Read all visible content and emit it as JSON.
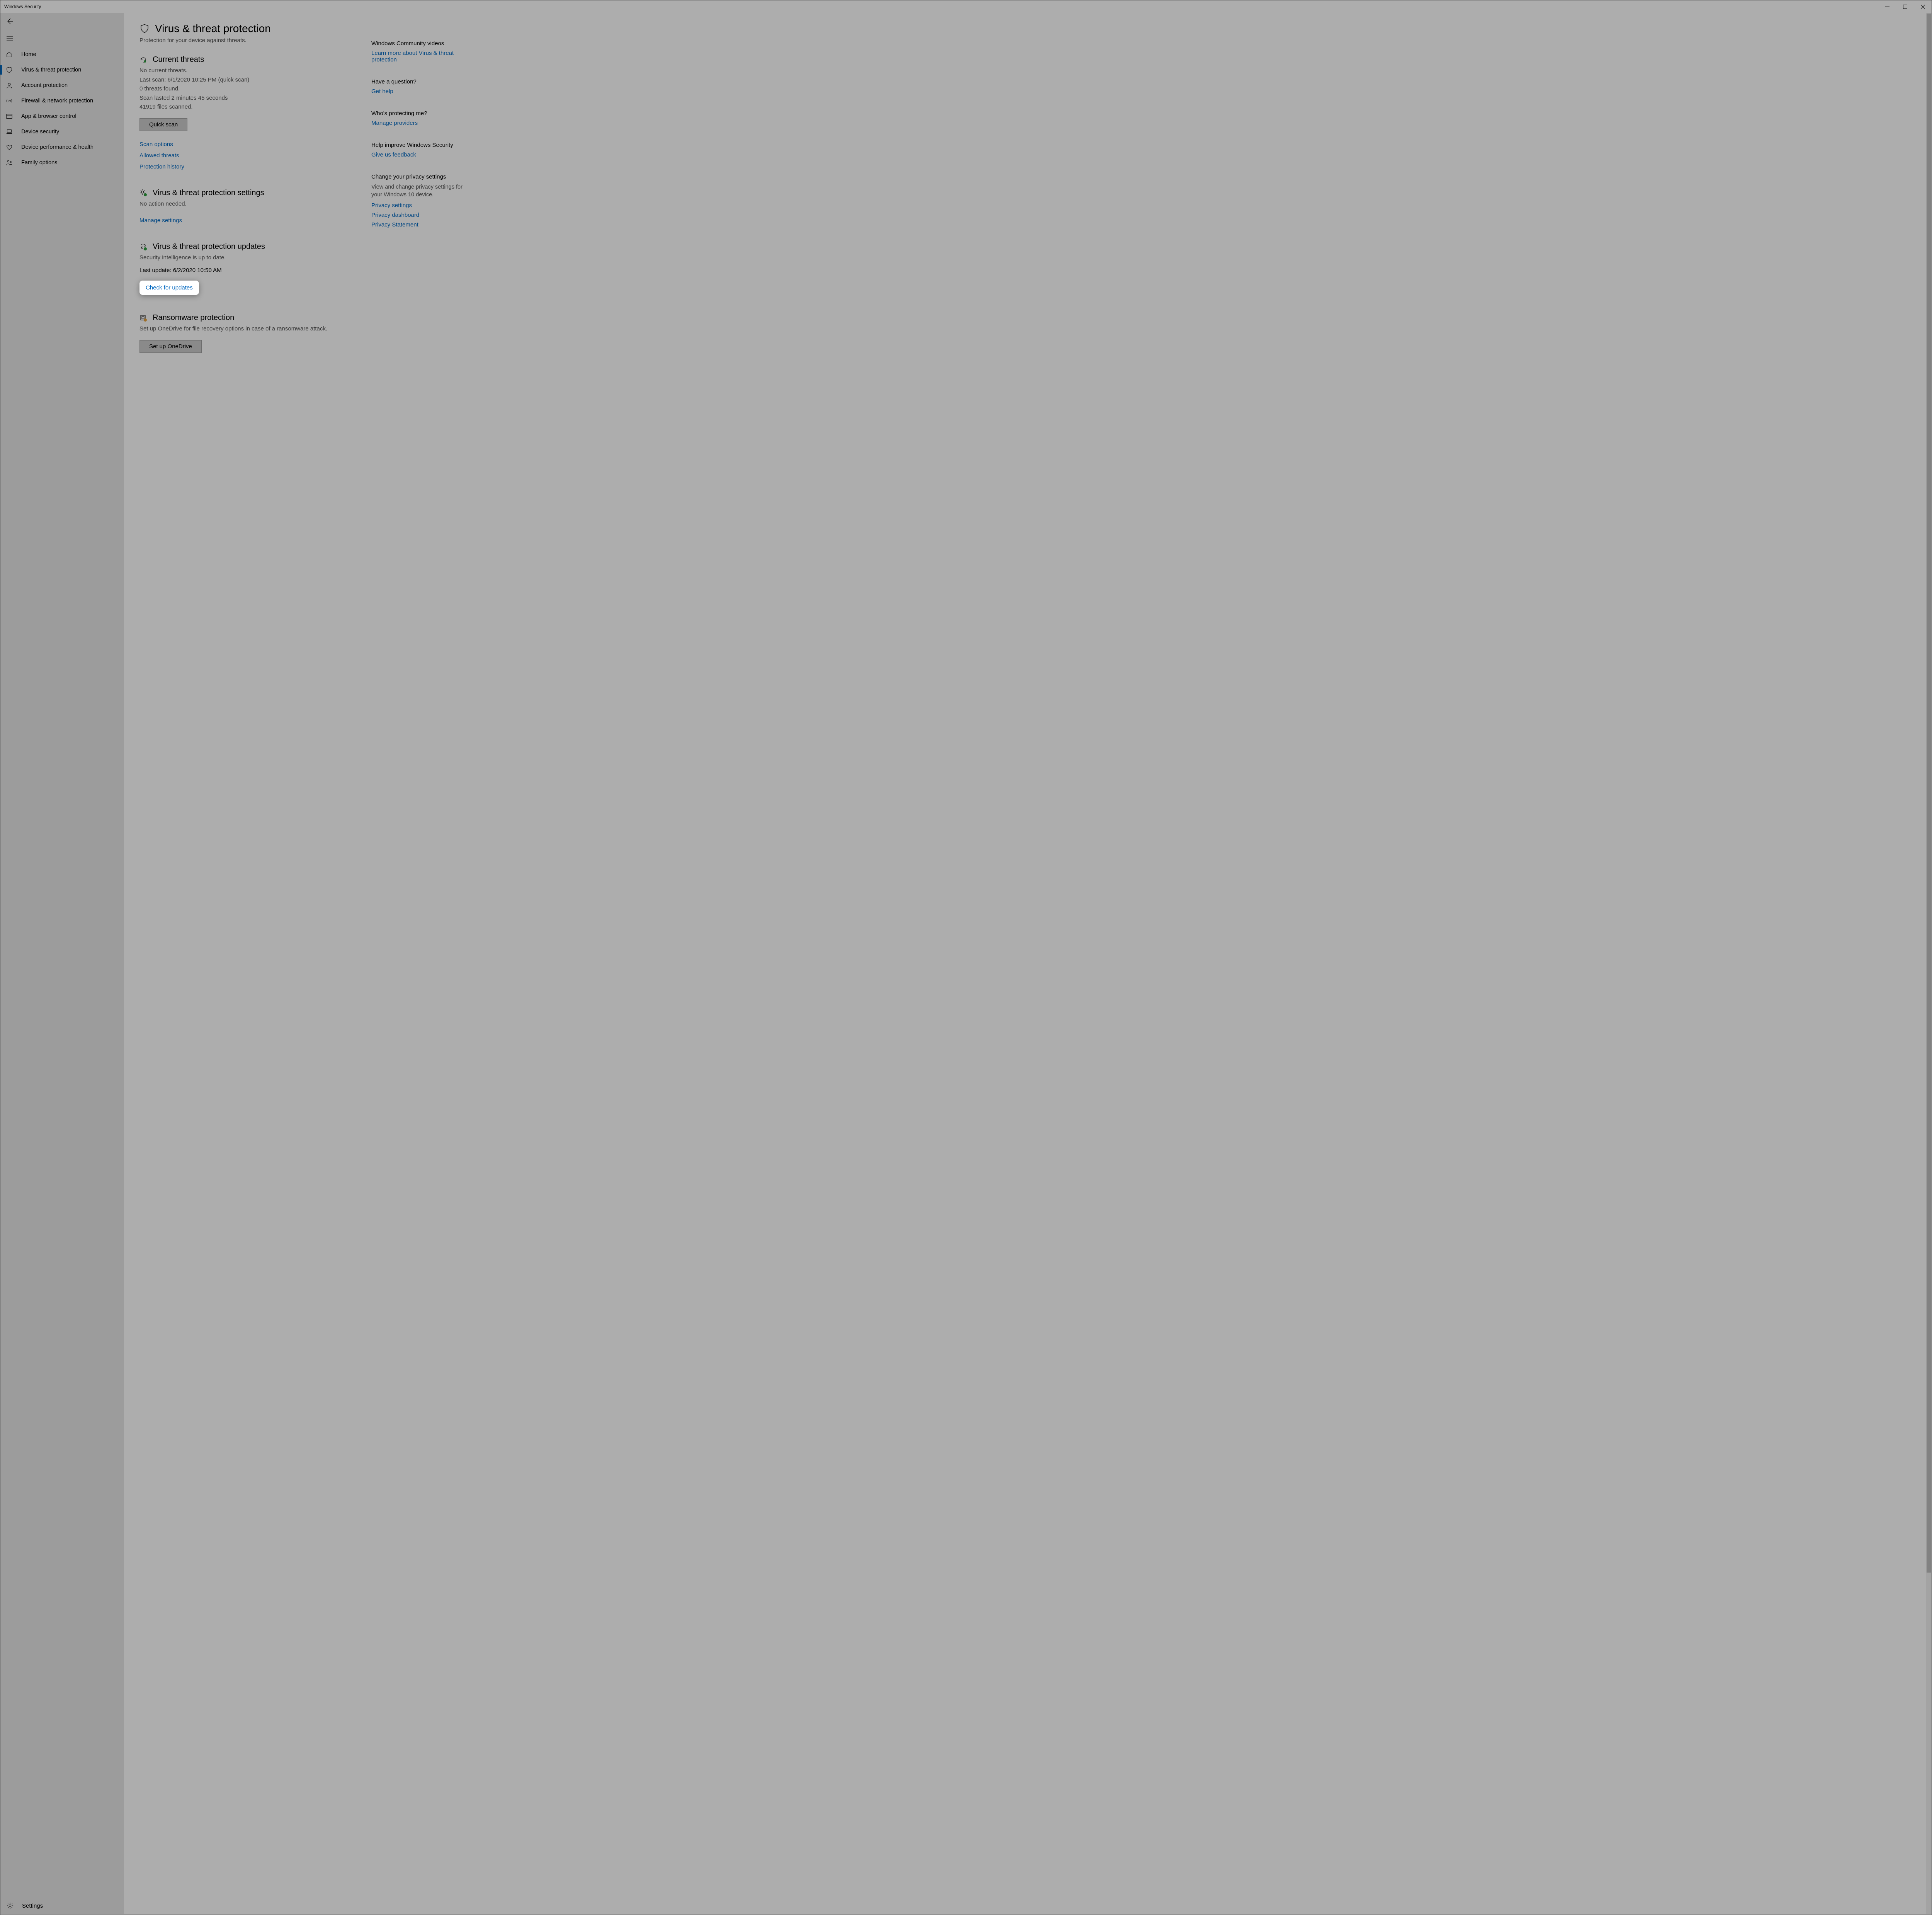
{
  "window_title": "Windows Security",
  "sidebar": {
    "items": [
      {
        "label": "Home"
      },
      {
        "label": "Virus & threat protection"
      },
      {
        "label": "Account protection"
      },
      {
        "label": "Firewall & network protection"
      },
      {
        "label": "App & browser control"
      },
      {
        "label": "Device security"
      },
      {
        "label": "Device performance & health"
      },
      {
        "label": "Family options"
      }
    ],
    "settings_label": "Settings"
  },
  "page": {
    "title": "Virus & threat protection",
    "subtitle": "Protection for your device against threats."
  },
  "current_threats": {
    "heading": "Current threats",
    "line1": "No current threats.",
    "line2": "Last scan: 6/1/2020 10:25 PM (quick scan)",
    "line3": "0 threats found.",
    "line4": "Scan lasted 2 minutes 45 seconds",
    "line5": "41919 files scanned.",
    "button": "Quick scan",
    "link1": "Scan options",
    "link2": "Allowed threats",
    "link3": "Protection history"
  },
  "settings_section": {
    "heading": "Virus & threat protection settings",
    "line1": "No action needed.",
    "link": "Manage settings"
  },
  "updates_section": {
    "heading": "Virus & threat protection updates",
    "line1": "Security intelligence is up to date.",
    "line2": "Last update: 6/2/2020 10:50 AM",
    "link": "Check for updates"
  },
  "ransomware": {
    "heading": "Ransomware protection",
    "line1": "Set up OneDrive for file recovery options in case of a ransomware attack.",
    "button": "Set up OneDrive"
  },
  "aside": {
    "community": {
      "heading": "Windows Community videos",
      "link": "Learn more about Virus & threat protection"
    },
    "question": {
      "heading": "Have a question?",
      "link": "Get help"
    },
    "protecting": {
      "heading": "Who's protecting me?",
      "link": "Manage providers"
    },
    "improve": {
      "heading": "Help improve Windows Security",
      "link": "Give us feedback"
    },
    "privacy": {
      "heading": "Change your privacy settings",
      "text": "View and change privacy settings for your Windows 10 device.",
      "link1": "Privacy settings",
      "link2": "Privacy dashboard",
      "link3": "Privacy Statement"
    }
  }
}
